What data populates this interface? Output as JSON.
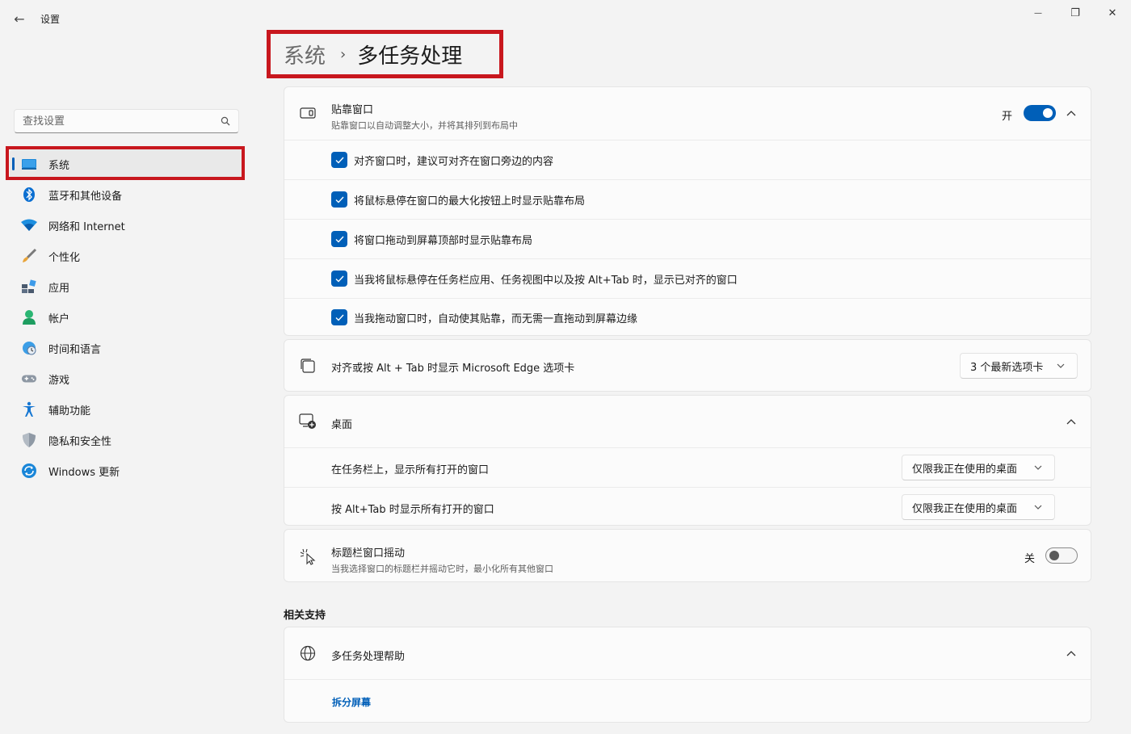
{
  "window": {
    "back_glyph": "←",
    "title": "设置",
    "minimize_glyph": "—",
    "maximize_glyph": "❐",
    "close_glyph": "✕"
  },
  "search": {
    "placeholder": "查找设置"
  },
  "sidebar": {
    "items": [
      {
        "label": "系统",
        "icon": "system-icon"
      },
      {
        "label": "蓝牙和其他设备",
        "icon": "bluetooth-icon"
      },
      {
        "label": "网络和 Internet",
        "icon": "wifi-icon"
      },
      {
        "label": "个性化",
        "icon": "brush-icon"
      },
      {
        "label": "应用",
        "icon": "apps-icon"
      },
      {
        "label": "帐户",
        "icon": "account-icon"
      },
      {
        "label": "时间和语言",
        "icon": "globe-clock-icon"
      },
      {
        "label": "游戏",
        "icon": "gamepad-icon"
      },
      {
        "label": "辅助功能",
        "icon": "accessibility-icon"
      },
      {
        "label": "隐私和安全性",
        "icon": "shield-icon"
      },
      {
        "label": "Windows 更新",
        "icon": "update-icon"
      }
    ]
  },
  "breadcrumb": {
    "parent": "系统",
    "separator": "›",
    "current": "多任务处理"
  },
  "snap": {
    "title": "贴靠窗口",
    "subtitle": "贴靠窗口以自动调整大小，并将其排列到布局中",
    "toggle_label": "开",
    "options": [
      "对齐窗口时，建议可对齐在窗口旁边的内容",
      "将鼠标悬停在窗口的最大化按钮上时显示贴靠布局",
      "将窗口拖动到屏幕顶部时显示贴靠布局",
      "当我将鼠标悬停在任务栏应用、任务视图中以及按 Alt+Tab 时，显示已对齐的窗口",
      "当我拖动窗口时，自动使其贴靠，而无需一直拖动到屏幕边缘"
    ]
  },
  "edge_tabs": {
    "title": "对齐或按 Alt + Tab 时显示 Microsoft Edge 选项卡",
    "value": "3 个最新选项卡"
  },
  "desktops": {
    "title": "桌面",
    "taskbar_label": "在任务栏上，显示所有打开的窗口",
    "taskbar_value": "仅限我正在使用的桌面",
    "alttab_label": "按 Alt+Tab 时显示所有打开的窗口",
    "alttab_value": "仅限我正在使用的桌面"
  },
  "shake": {
    "title": "标题栏窗口摇动",
    "subtitle": "当我选择窗口的标题栏并摇动它时，最小化所有其他窗口",
    "toggle_label": "关"
  },
  "related": {
    "heading": "相关支持",
    "help_title": "多任务处理帮助",
    "link": "拆分屏幕"
  },
  "colors": {
    "accent": "#005fb8",
    "highlight": "#c8171e"
  }
}
